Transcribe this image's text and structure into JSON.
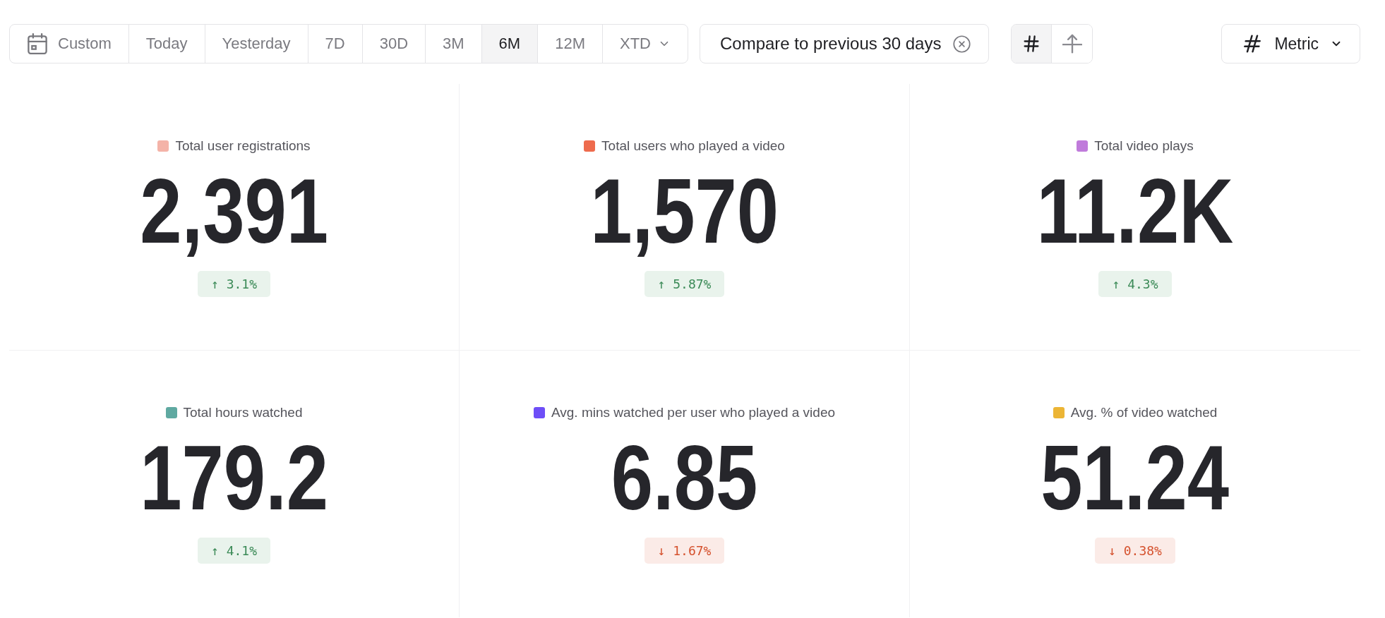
{
  "date_range": [
    {
      "label": "Custom",
      "kind": "custom",
      "selected": false
    },
    {
      "label": "Today",
      "kind": "preset",
      "selected": false
    },
    {
      "label": "Yesterday",
      "kind": "preset",
      "selected": false
    },
    {
      "label": "7D",
      "kind": "preset",
      "selected": false
    },
    {
      "label": "30D",
      "kind": "preset",
      "selected": false
    },
    {
      "label": "3M",
      "kind": "preset",
      "selected": false
    },
    {
      "label": "6M",
      "kind": "preset",
      "selected": true
    },
    {
      "label": "12M",
      "kind": "preset",
      "selected": false
    },
    {
      "label": "XTD",
      "kind": "dropdown",
      "selected": false
    }
  ],
  "compare_button": {
    "label": "Compare to previous 30 days"
  },
  "view_toggle": [
    {
      "kind": "number",
      "selected": true
    },
    {
      "kind": "trend",
      "selected": false
    }
  ],
  "metric_select": {
    "label": "Metric"
  },
  "metrics": [
    {
      "label": "Total user registrations",
      "color": "#f4b3a8",
      "value": "2,391",
      "change": "↑ 3.1%",
      "increase": true
    },
    {
      "label": "Total users who played a video",
      "color": "#ee6b4d",
      "value": "1,570",
      "change": "↑ 5.87%",
      "increase": true
    },
    {
      "label": "Total video plays",
      "color": "#c07bdb",
      "value": "11.2K",
      "change": "↑ 4.3%",
      "increase": true
    },
    {
      "label": "Total hours watched",
      "color": "#5fa9a1",
      "value": "179.2",
      "change": "↑ 4.1%",
      "increase": true
    },
    {
      "label": "Avg. mins watched per user who played a video",
      "color": "#6e4ef7",
      "value": "6.85",
      "change": "↓ 1.67%",
      "increase": false
    },
    {
      "label": "Avg. % of video watched",
      "color": "#ecb535",
      "value": "51.24",
      "change": "↓ 0.38%",
      "increase": false
    }
  ]
}
